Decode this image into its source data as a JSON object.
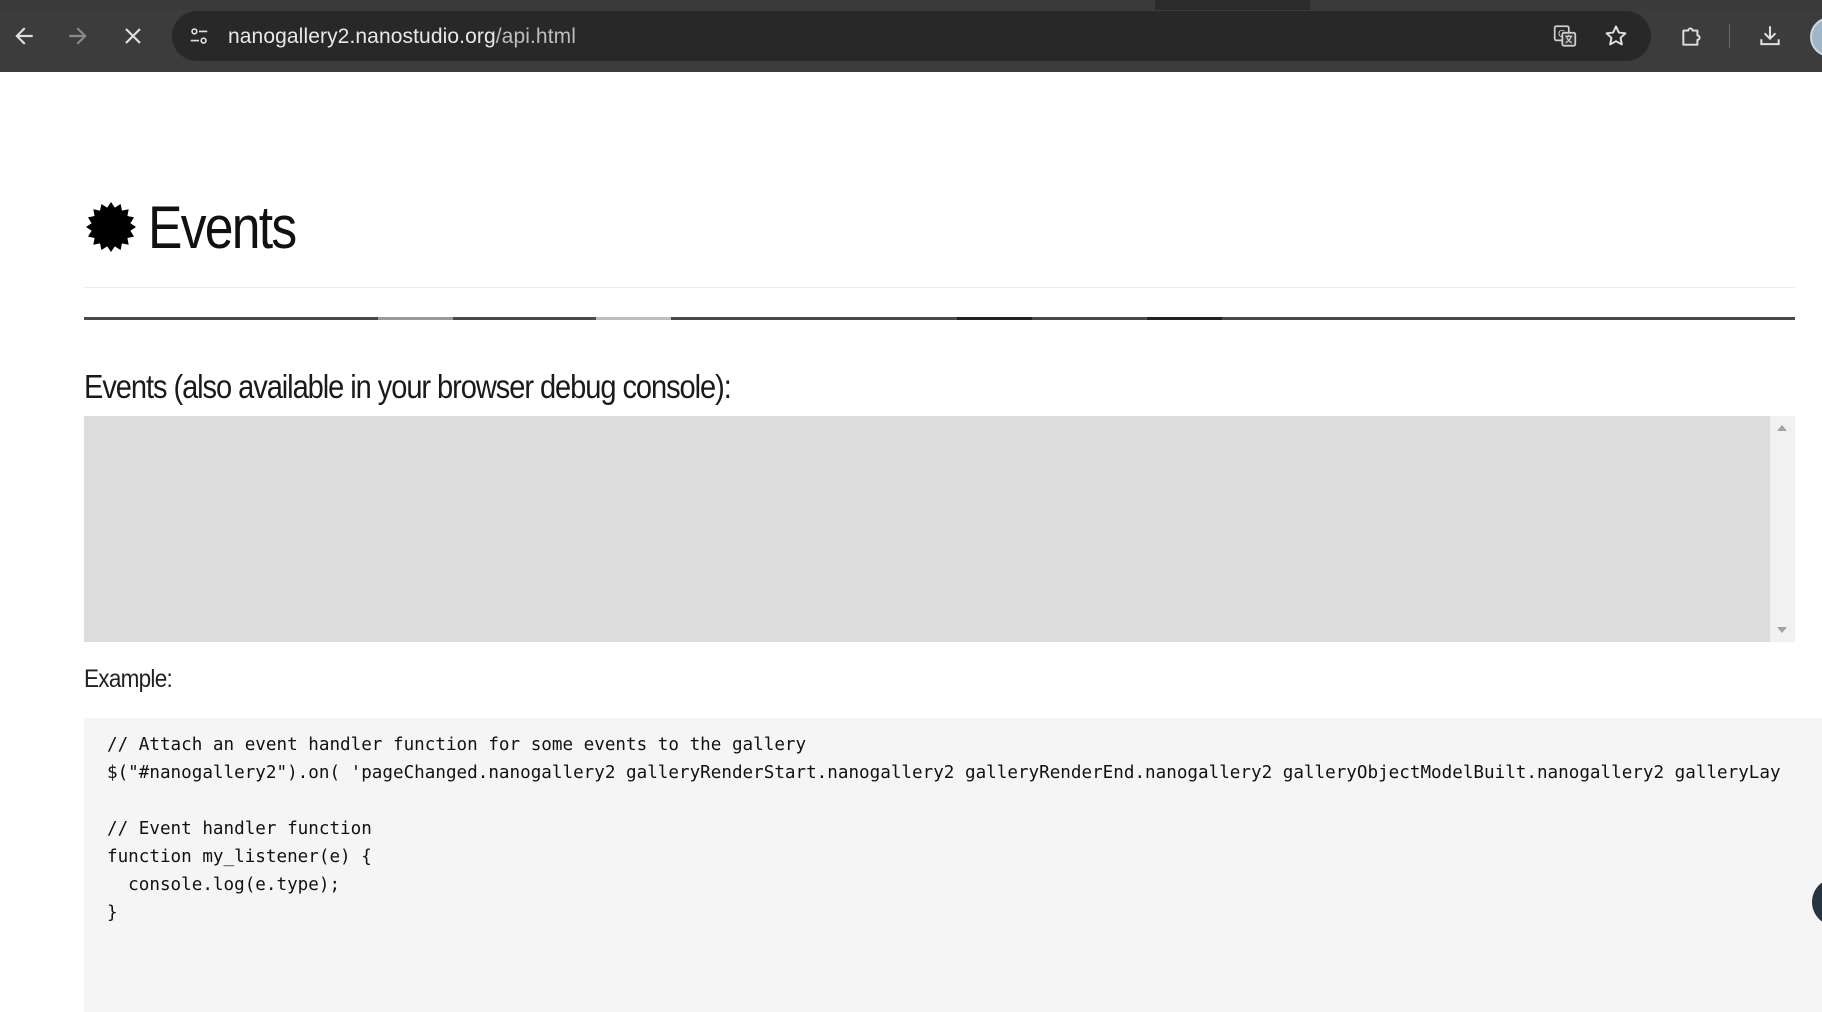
{
  "browser": {
    "url_host": "nanogallery2.nanostudio.org",
    "url_path": "/api.html",
    "icons": {
      "back": "arrow-left-icon",
      "forward": "arrow-right-icon",
      "stop": "close-icon",
      "site_info": "tune-icon",
      "translate": "translate-icon",
      "bookmark": "star-outline-icon",
      "extensions": "puzzle-icon",
      "downloads": "download-icon",
      "profile": "avatar-icon"
    }
  },
  "page": {
    "heading": "Events",
    "heading_icon": "badge-burst-icon",
    "events_label": "Events (also available in your browser debug console):",
    "events_log": "",
    "example_label": "Example:",
    "code_lines": [
      "// Attach an event handler function for some events to the gallery",
      "$(\"#nanogallery2\").on( 'pageChanged.nanogallery2 galleryRenderStart.nanogallery2 galleryRenderEnd.nanogallery2 galleryObjectModelBuilt.nanogallery2 galleryLay",
      "",
      "// Event handler function",
      "function my_listener(e) {",
      "  console.log(e.type);",
      "}"
    ]
  },
  "colors": {
    "chrome_bg": "#3c3c3c",
    "omnibox_bg": "#282828",
    "events_box_bg": "#dcdcdc",
    "code_bg": "#f5f5f5"
  }
}
